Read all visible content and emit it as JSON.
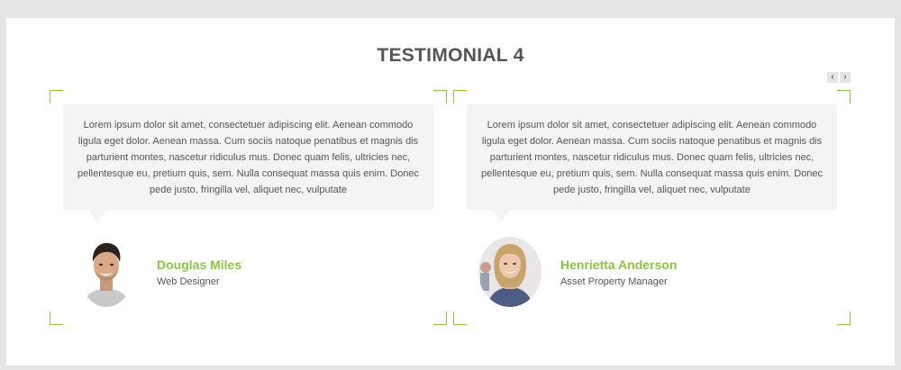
{
  "section": {
    "title": "TESTIMONIAL 4"
  },
  "carousel": {
    "prev_icon": "chevron-left-icon",
    "next_icon": "chevron-right-icon",
    "prev_glyph": "‹",
    "next_glyph": "›"
  },
  "colors": {
    "accent": "#8cc63f",
    "bubble_bg": "#f4f4f4",
    "text": "#555555",
    "title": "#555555",
    "page_bg": "#e5e5e5"
  },
  "testimonials": [
    {
      "quote": "Lorem ipsum dolor sit amet, consectetuer adipiscing elit. Aenean commodo ligula eget dolor. Aenean massa. Cum sociis natoque penatibus et magnis dis parturient montes, nascetur ridiculus mus. Donec quam felis, ultricies nec, pellentesque eu, pretium quis, sem. Nulla consequat massa quis enim. Donec pede justo, fringilla vel, aliquet nec, vulputate",
      "name": "Douglas Miles",
      "role": "Web Designer",
      "avatar_icon": "man-avatar"
    },
    {
      "quote": "Lorem ipsum dolor sit amet, consectetuer adipiscing elit. Aenean commodo ligula eget dolor. Aenean massa. Cum sociis natoque penatibus et magnis dis parturient montes, nascetur ridiculus mus. Donec quam felis, ultricies nec, pellentesque eu, pretium quis, sem. Nulla consequat massa quis enim. Donec pede justo, fringilla vel, aliquet nec, vulputate",
      "name": "Henrietta Anderson",
      "role": "Asset Property Manager",
      "avatar_icon": "woman-avatar"
    }
  ]
}
